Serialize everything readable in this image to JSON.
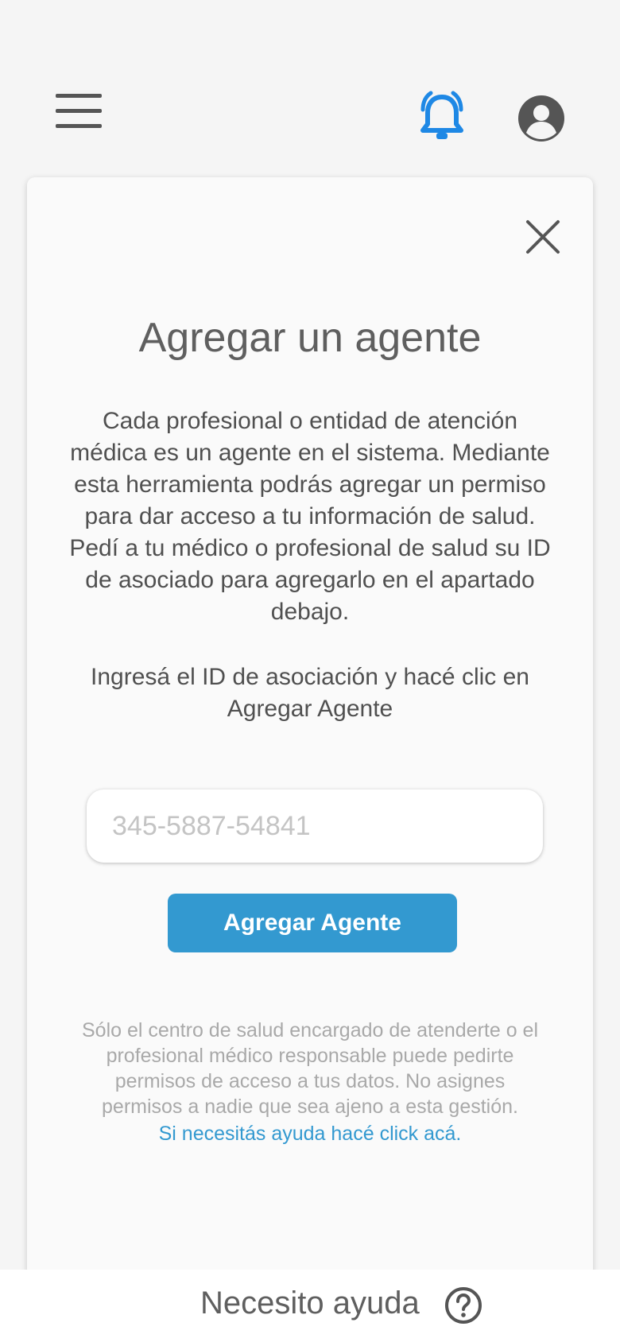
{
  "header": {
    "menu_icon": "hamburger-menu-icon",
    "bell_icon": "bell-ringing-icon",
    "avatar_icon": "account-circle-icon",
    "bell_color": "#1e88e5"
  },
  "card": {
    "close_icon": "close-icon",
    "title": "Agregar un agente",
    "description": "Cada profesional o entidad de atención médica es un agente en el sistema. Mediante esta herramienta podrás agregar un permiso para dar acceso a tu información de salud. Pedí a tu médico o profesional de salud su ID de asociado para agregarlo en el apartado debajo.",
    "instruction": "Ingresá el ID de asociación y hacé clic en Agregar Agente",
    "input": {
      "placeholder": "345-5887-54841",
      "value": ""
    },
    "add_button": "Agregar Agente",
    "disclaimer": "Sólo el centro de salud encargado de atenderte o el profesional médico responsable puede pedirte permisos de acceso a tus datos. No asignes permisos a nadie que sea ajeno a esta gestión.",
    "help_link": "Si necesitás ayuda hacé click acá."
  },
  "footer": {
    "label": "Necesito ayuda",
    "help_icon": "question-circle-icon"
  },
  "colors": {
    "accent": "#3399d0",
    "text_primary": "#5f5f5f",
    "text_muted": "#a9a9a9"
  }
}
